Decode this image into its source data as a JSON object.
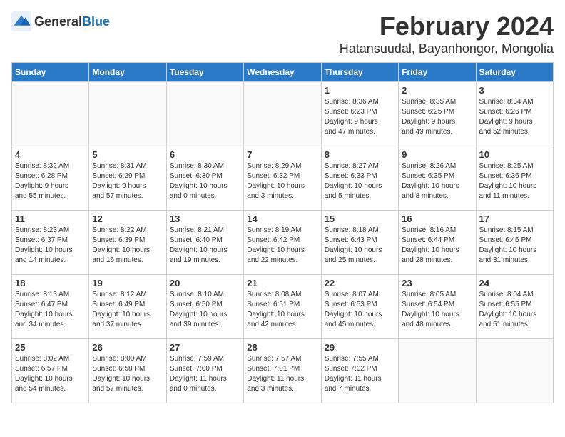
{
  "header": {
    "logo_general": "General",
    "logo_blue": "Blue",
    "month": "February 2024",
    "location": "Hatansuudal, Bayanhongor, Mongolia"
  },
  "days_of_week": [
    "Sunday",
    "Monday",
    "Tuesday",
    "Wednesday",
    "Thursday",
    "Friday",
    "Saturday"
  ],
  "weeks": [
    [
      {
        "day": "",
        "info": ""
      },
      {
        "day": "",
        "info": ""
      },
      {
        "day": "",
        "info": ""
      },
      {
        "day": "",
        "info": ""
      },
      {
        "day": "1",
        "info": "Sunrise: 8:36 AM\nSunset: 6:23 PM\nDaylight: 9 hours\nand 47 minutes."
      },
      {
        "day": "2",
        "info": "Sunrise: 8:35 AM\nSunset: 6:25 PM\nDaylight: 9 hours\nand 49 minutes."
      },
      {
        "day": "3",
        "info": "Sunrise: 8:34 AM\nSunset: 6:26 PM\nDaylight: 9 hours\nand 52 minutes."
      }
    ],
    [
      {
        "day": "4",
        "info": "Sunrise: 8:32 AM\nSunset: 6:28 PM\nDaylight: 9 hours\nand 55 minutes."
      },
      {
        "day": "5",
        "info": "Sunrise: 8:31 AM\nSunset: 6:29 PM\nDaylight: 9 hours\nand 57 minutes."
      },
      {
        "day": "6",
        "info": "Sunrise: 8:30 AM\nSunset: 6:30 PM\nDaylight: 10 hours\nand 0 minutes."
      },
      {
        "day": "7",
        "info": "Sunrise: 8:29 AM\nSunset: 6:32 PM\nDaylight: 10 hours\nand 3 minutes."
      },
      {
        "day": "8",
        "info": "Sunrise: 8:27 AM\nSunset: 6:33 PM\nDaylight: 10 hours\nand 5 minutes."
      },
      {
        "day": "9",
        "info": "Sunrise: 8:26 AM\nSunset: 6:35 PM\nDaylight: 10 hours\nand 8 minutes."
      },
      {
        "day": "10",
        "info": "Sunrise: 8:25 AM\nSunset: 6:36 PM\nDaylight: 10 hours\nand 11 minutes."
      }
    ],
    [
      {
        "day": "11",
        "info": "Sunrise: 8:23 AM\nSunset: 6:37 PM\nDaylight: 10 hours\nand 14 minutes."
      },
      {
        "day": "12",
        "info": "Sunrise: 8:22 AM\nSunset: 6:39 PM\nDaylight: 10 hours\nand 16 minutes."
      },
      {
        "day": "13",
        "info": "Sunrise: 8:21 AM\nSunset: 6:40 PM\nDaylight: 10 hours\nand 19 minutes."
      },
      {
        "day": "14",
        "info": "Sunrise: 8:19 AM\nSunset: 6:42 PM\nDaylight: 10 hours\nand 22 minutes."
      },
      {
        "day": "15",
        "info": "Sunrise: 8:18 AM\nSunset: 6:43 PM\nDaylight: 10 hours\nand 25 minutes."
      },
      {
        "day": "16",
        "info": "Sunrise: 8:16 AM\nSunset: 6:44 PM\nDaylight: 10 hours\nand 28 minutes."
      },
      {
        "day": "17",
        "info": "Sunrise: 8:15 AM\nSunset: 6:46 PM\nDaylight: 10 hours\nand 31 minutes."
      }
    ],
    [
      {
        "day": "18",
        "info": "Sunrise: 8:13 AM\nSunset: 6:47 PM\nDaylight: 10 hours\nand 34 minutes."
      },
      {
        "day": "19",
        "info": "Sunrise: 8:12 AM\nSunset: 6:49 PM\nDaylight: 10 hours\nand 37 minutes."
      },
      {
        "day": "20",
        "info": "Sunrise: 8:10 AM\nSunset: 6:50 PM\nDaylight: 10 hours\nand 39 minutes."
      },
      {
        "day": "21",
        "info": "Sunrise: 8:08 AM\nSunset: 6:51 PM\nDaylight: 10 hours\nand 42 minutes."
      },
      {
        "day": "22",
        "info": "Sunrise: 8:07 AM\nSunset: 6:53 PM\nDaylight: 10 hours\nand 45 minutes."
      },
      {
        "day": "23",
        "info": "Sunrise: 8:05 AM\nSunset: 6:54 PM\nDaylight: 10 hours\nand 48 minutes."
      },
      {
        "day": "24",
        "info": "Sunrise: 8:04 AM\nSunset: 6:55 PM\nDaylight: 10 hours\nand 51 minutes."
      }
    ],
    [
      {
        "day": "25",
        "info": "Sunrise: 8:02 AM\nSunset: 6:57 PM\nDaylight: 10 hours\nand 54 minutes."
      },
      {
        "day": "26",
        "info": "Sunrise: 8:00 AM\nSunset: 6:58 PM\nDaylight: 10 hours\nand 57 minutes."
      },
      {
        "day": "27",
        "info": "Sunrise: 7:59 AM\nSunset: 7:00 PM\nDaylight: 11 hours\nand 0 minutes."
      },
      {
        "day": "28",
        "info": "Sunrise: 7:57 AM\nSunset: 7:01 PM\nDaylight: 11 hours\nand 3 minutes."
      },
      {
        "day": "29",
        "info": "Sunrise: 7:55 AM\nSunset: 7:02 PM\nDaylight: 11 hours\nand 7 minutes."
      },
      {
        "day": "",
        "info": ""
      },
      {
        "day": "",
        "info": ""
      }
    ]
  ]
}
